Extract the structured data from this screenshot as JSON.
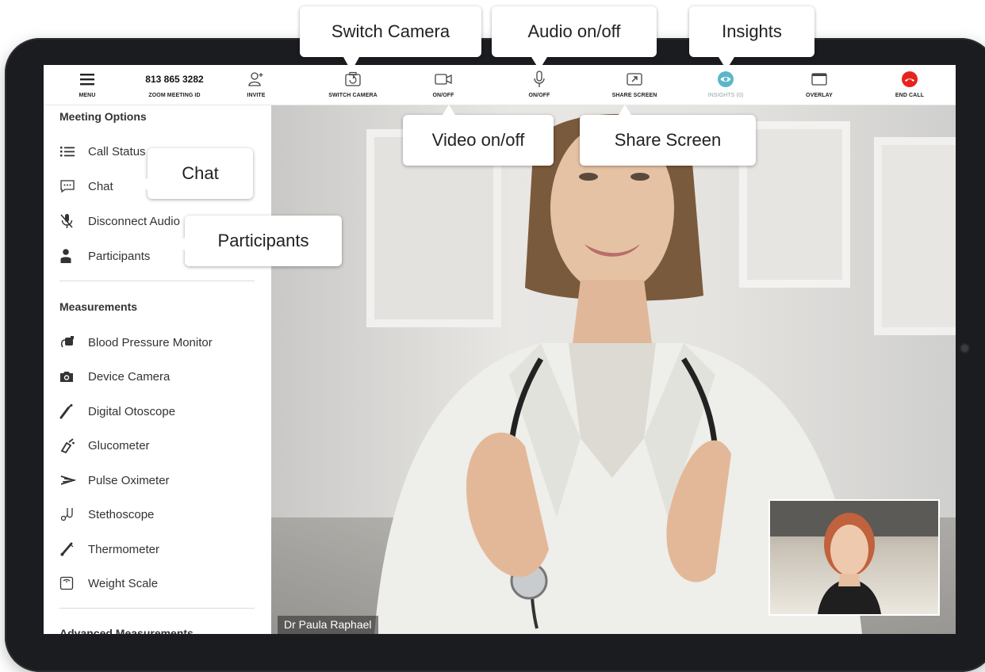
{
  "toolbar": {
    "menu": "MENU",
    "meeting_id_value": "813 865 3282",
    "meeting_id_label": "ZOOM MEETING ID",
    "invite": "INVITE",
    "switch_camera": "SWITCH CAMERA",
    "video_toggle": "ON/OFF",
    "audio_toggle": "ON/OFF",
    "share_screen": "SHARE SCREEN",
    "insights": "INSIGHTS (0)",
    "overlay": "OVERLAY",
    "end_call": "END CALL"
  },
  "sidebar": {
    "meeting_options_title": "Meeting Options",
    "meeting_options": [
      {
        "label": "Call Status",
        "icon": "list-icon"
      },
      {
        "label": "Chat",
        "icon": "chat-icon"
      },
      {
        "label": "Disconnect Audio",
        "icon": "mic-off-icon"
      },
      {
        "label": "Participants",
        "icon": "person-icon"
      }
    ],
    "measurements_title": "Measurements",
    "measurements": [
      {
        "label": "Blood Pressure Monitor",
        "icon": "blood-pressure-icon"
      },
      {
        "label": "Device Camera",
        "icon": "camera-icon"
      },
      {
        "label": "Digital Otoscope",
        "icon": "otoscope-icon"
      },
      {
        "label": "Glucometer",
        "icon": "glucometer-icon"
      },
      {
        "label": "Pulse Oximeter",
        "icon": "pulse-oximeter-icon"
      },
      {
        "label": "Stethoscope",
        "icon": "stethoscope-icon"
      },
      {
        "label": "Thermometer",
        "icon": "thermometer-icon"
      },
      {
        "label": "Weight Scale",
        "icon": "weight-scale-icon"
      }
    ],
    "advanced_title": "Advanced Measurements"
  },
  "video": {
    "participant_name": "Dr Paula Raphael"
  },
  "callouts": {
    "switch_camera": "Switch Camera",
    "audio": "Audio on/off",
    "insights": "Insights",
    "video": "Video on/off",
    "share_screen": "Share Screen",
    "chat": "Chat",
    "participants": "Participants"
  },
  "colors": {
    "end_call": "#e8231e",
    "insights": "#5bb6c9",
    "frame": "#1b1c1f"
  }
}
